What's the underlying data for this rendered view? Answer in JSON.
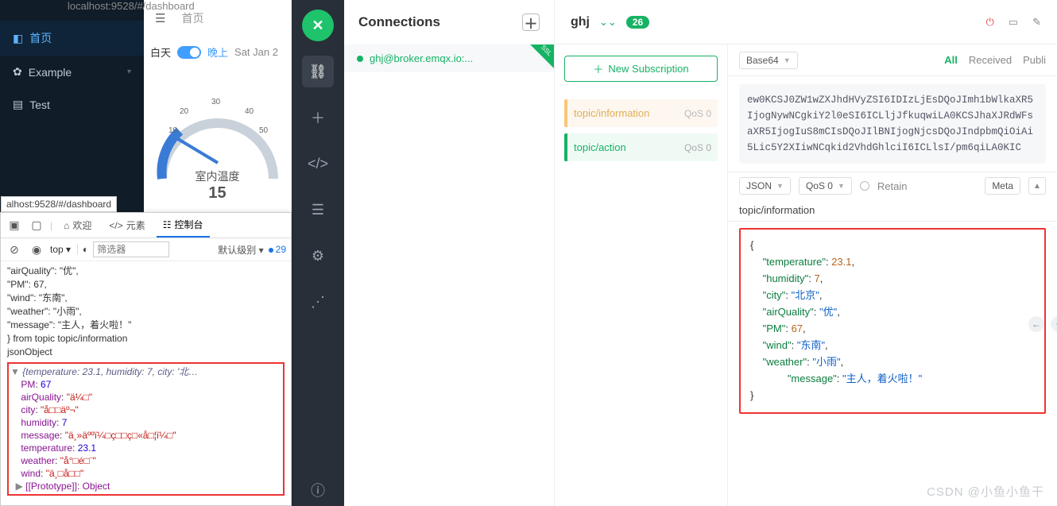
{
  "dash": {
    "url_top": "localhost:9528/#/dashboard",
    "home": "首页",
    "example": "Example",
    "test": "Test",
    "lp_home": "首页",
    "day": "白天",
    "night": "晚上",
    "date": "Sat Jan 2",
    "gauge_label": "室内温度",
    "gauge_val": "15",
    "ticks": {
      "t10": "10",
      "t20": "20",
      "t30": "30",
      "t40": "40",
      "t50": "50"
    }
  },
  "devtools": {
    "tooltip": "alhost:9528/#/dashboard",
    "tab_welcome": "欢迎",
    "tab_elements": "元素",
    "tab_console": "控制台",
    "top": "top",
    "filter_ph": "筛选器",
    "level": "默认级别",
    "count": "29",
    "pre_lines": [
      "  \"airQuality\": \"优\",",
      "  \"PM\": 67,",
      "  \"wind\": \"东南\",",
      "  \"weather\": \"小雨\",",
      "      \"message\": \"主人，着火啦！\"",
      "} from topic topic/information"
    ],
    "jsonObj_label": "jsonObject",
    "obj_summary": "{temperature: 23.1, humidity: 7, city: '北…",
    "obj": {
      "PM": "67",
      "airQuality": "\"ä¼□\"",
      "city": "\"å□□äº¬\"",
      "humidity": "7",
      "message": "\"ä¸»äººï¼□ç□□ç□«å□¦ï¼□\"",
      "temperature": "23.1",
      "weather": "\"å°□é□¨\"",
      "wind": "\"ä¸□å□□\""
    },
    "proto": "[[Prototype]]: Object"
  },
  "mx": {
    "title": "Connections",
    "conn1": "ghj@broker.emqx.io:...",
    "ssl": "SSL",
    "client": "ghj",
    "badge": "26",
    "newsub": "New Subscription",
    "sub1": "topic/information",
    "sub2": "topic/action",
    "qos": "QoS 0",
    "sel_base64": "Base64",
    "flt_all": "All",
    "flt_recv": "Received",
    "flt_pub": "Publi",
    "blob": "ew0KCSJ0ZW1wZXJhdHVyZSI6IDIzLjEsDQoJImh1bWlkaXR5IjogNywNCgkiY2l0eSI6ICLljJfkuqwiLA0KCSJhaXJRdWFsaXR5IjogIuS8mCIsDQoJIlBNIjogNjcsDQoJIndpbmQiOiAi5Lic5Y2XIiwNCqkid2VhdGhlciI6ICLlsI/pm6qiLA0KIC",
    "sel_json": "JSON",
    "sel_qos": "QoS 0",
    "retain": "Retain",
    "meta": "Meta",
    "topic_input": "topic/information",
    "payload": {
      "k_temp": "\"temperature\"",
      "v_temp": "23.1",
      "k_hum": "\"humidity\"",
      "v_hum": "7",
      "k_city": "\"city\"",
      "v_city": "\"北京\"",
      "k_aq": "\"airQuality\"",
      "v_aq": "\"优\"",
      "k_pm": "\"PM\"",
      "v_pm": "67",
      "k_wind": "\"wind\"",
      "v_wind": "\"东南\"",
      "k_wea": "\"weather\"",
      "v_wea": "\"小雨\"",
      "k_msg": "\"message\"",
      "v_msg": "\"主人，着火啦！\""
    }
  },
  "chart_data": {
    "type": "gauge",
    "title": "室内温度",
    "value": 15,
    "min": 0,
    "max": 60,
    "ticks": [
      10,
      20,
      30,
      40,
      50
    ]
  },
  "watermark": "CSDN @小鱼小鱼干"
}
